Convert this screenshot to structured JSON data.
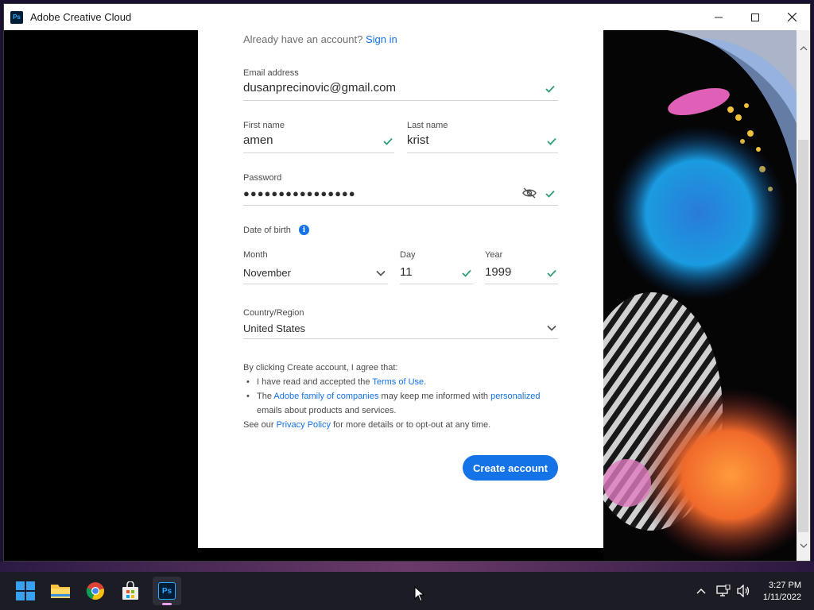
{
  "window": {
    "title": "Adobe Creative Cloud",
    "app_icon_text": "Ps"
  },
  "form": {
    "signin_prompt": "Already have an account?",
    "signin_link": "Sign in",
    "email": {
      "label": "Email address",
      "value": "dusanprecinovic@gmail.com"
    },
    "first_name": {
      "label": "First name",
      "value": "amen"
    },
    "last_name": {
      "label": "Last name",
      "value": "krist"
    },
    "password": {
      "label": "Password",
      "value": "●●●●●●●●●●●●●●●●"
    },
    "dob": {
      "label": "Date of birth",
      "month": {
        "label": "Month",
        "value": "November"
      },
      "day": {
        "label": "Day",
        "value": "11"
      },
      "year": {
        "label": "Year",
        "value": "1999"
      }
    },
    "country": {
      "label": "Country/Region",
      "value": "United States"
    },
    "legal": {
      "intro": "By clicking Create account, I agree that:",
      "b1_pre": "I have read and accepted the ",
      "b1_link": "Terms of Use",
      "b1_post": ".",
      "b2_pre": "The ",
      "b2_link1": "Adobe family of companies",
      "b2_mid": " may keep me informed with ",
      "b2_link2": "personalized",
      "b2_post": " emails about products and services.",
      "outro_pre": "See our ",
      "outro_link": "Privacy Policy",
      "outro_post": " for more details or to opt-out at any time."
    },
    "create_button": "Create account"
  },
  "taskbar": {
    "ps_label": "Ps",
    "time": "3:27 PM",
    "date": "1/11/2022"
  },
  "colors": {
    "accent": "#1473e6",
    "check": "#2d9d78"
  }
}
